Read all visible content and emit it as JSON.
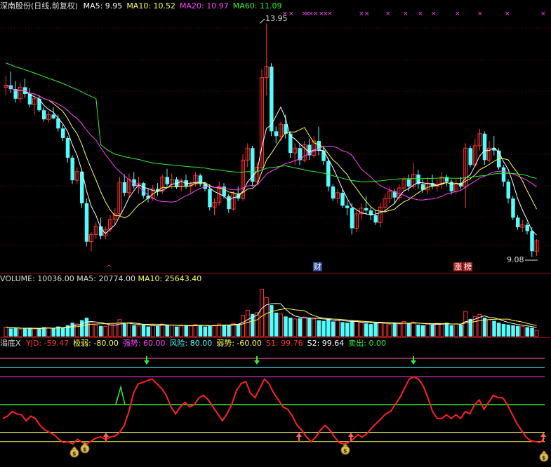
{
  "main": {
    "stock_title": "深南股份(日线,前复权)",
    "ma": [
      {
        "label": "MA5: ",
        "value": "9.95",
        "color": "#ffffff"
      },
      {
        "label": "MA10: ",
        "value": "10.52",
        "color": "#ffff55"
      },
      {
        "label": "MA20: ",
        "value": "10.97",
        "color": "#ff44ff"
      },
      {
        "label": "MA60: ",
        "value": "11.09",
        "color": "#33ee33"
      }
    ],
    "high_label": "13.95",
    "low_label": "9.08",
    "markers": [
      {
        "text": "财",
        "color": "#ffffff",
        "bg": "#2a4a9a"
      },
      {
        "text": "涨",
        "color": "#ffffff",
        "bg": "#aa2222"
      },
      {
        "text": "榜",
        "color": "#ffffff",
        "bg": "#aa2222"
      }
    ],
    "colors": {
      "up": "#ff3232",
      "down": "#54fcfc",
      "ma5": "#ffffff",
      "ma10": "#ffff55",
      "ma20": "#ff44ff",
      "ma60": "#33ee33",
      "grid": "#7a0000"
    }
  },
  "volume": {
    "label": "VOLUME: ",
    "value": "10036.00",
    "ma5_label": "MA5: ",
    "ma5_value": "20774.00",
    "ma10_label": "MA10: ",
    "ma10_value": "25643.40"
  },
  "indicator": {
    "name": "渴底X",
    "items": [
      {
        "label": "YJD: ",
        "value": "-59.47",
        "color": "#ff3333"
      },
      {
        "label": "极弱: ",
        "value": "-80.00",
        "color": "#ffff55"
      },
      {
        "label": "强势: ",
        "value": "60.00",
        "color": "#ff44ff"
      },
      {
        "label": "风险: ",
        "value": "80.00",
        "color": "#54fcfc"
      },
      {
        "label": "弱势: ",
        "value": "-60.00",
        "color": "#ffff55"
      },
      {
        "label": "S1: ",
        "value": "99.76",
        "color": "#ff3333"
      },
      {
        "label": "S2: ",
        "value": "99.64",
        "color": "#ffffff"
      },
      {
        "label": "卖出: ",
        "value": "0.00",
        "color": "#33ee33"
      }
    ],
    "money_glyph": "$"
  },
  "candles": [
    [
      12.62,
      12.85,
      12.45,
      12.66
    ],
    [
      12.66,
      12.95,
      12.5,
      12.58
    ],
    [
      12.58,
      12.75,
      12.3,
      12.38
    ],
    [
      12.38,
      12.72,
      12.3,
      12.62
    ],
    [
      12.62,
      12.8,
      12.4,
      12.48
    ],
    [
      12.48,
      12.6,
      12.2,
      12.26
    ],
    [
      12.26,
      12.45,
      12.05,
      12.38
    ],
    [
      12.38,
      12.45,
      12.1,
      12.14
    ],
    [
      12.14,
      12.2,
      11.9,
      11.95
    ],
    [
      11.95,
      12.12,
      11.88,
      12.05
    ],
    [
      12.05,
      12.2,
      11.95,
      11.97
    ],
    [
      11.97,
      12.05,
      11.7,
      11.76
    ],
    [
      11.76,
      11.84,
      11.5,
      11.56
    ],
    [
      11.56,
      11.6,
      11.05,
      11.15
    ],
    [
      11.15,
      11.2,
      10.6,
      10.68
    ],
    [
      10.68,
      10.95,
      10.6,
      10.86
    ],
    [
      10.86,
      10.9,
      10.1,
      10.2
    ],
    [
      10.2,
      10.3,
      9.3,
      9.4
    ],
    [
      9.4,
      9.6,
      9.2,
      9.55
    ],
    [
      9.55,
      9.8,
      9.45,
      9.72
    ],
    [
      9.72,
      9.9,
      9.45,
      9.52
    ],
    [
      9.52,
      9.72,
      9.45,
      9.66
    ],
    [
      9.66,
      9.95,
      9.6,
      9.86
    ],
    [
      9.86,
      10.1,
      9.75,
      9.98
    ],
    [
      9.98,
      10.75,
      9.95,
      10.64
    ],
    [
      10.64,
      10.8,
      10.35,
      10.42
    ],
    [
      10.42,
      10.82,
      10.3,
      10.7
    ],
    [
      10.7,
      10.85,
      10.5,
      10.56
    ],
    [
      10.56,
      10.75,
      10.4,
      10.62
    ],
    [
      10.62,
      10.65,
      10.3,
      10.36
    ],
    [
      10.36,
      10.5,
      10.22,
      10.3
    ],
    [
      10.3,
      10.58,
      10.25,
      10.5
    ],
    [
      10.5,
      10.62,
      10.35,
      10.45
    ],
    [
      10.45,
      10.8,
      10.4,
      10.75
    ],
    [
      10.75,
      10.92,
      10.55,
      10.6
    ],
    [
      10.6,
      10.82,
      10.5,
      10.7
    ],
    [
      10.7,
      10.75,
      10.5,
      10.55
    ],
    [
      10.55,
      10.72,
      10.45,
      10.68
    ],
    [
      10.68,
      10.8,
      10.5,
      10.56
    ],
    [
      10.56,
      10.66,
      10.4,
      10.6
    ],
    [
      10.6,
      10.85,
      10.55,
      10.78
    ],
    [
      10.78,
      10.82,
      10.55,
      10.6
    ],
    [
      10.6,
      10.65,
      10.45,
      10.5
    ],
    [
      10.5,
      10.6,
      10.05,
      10.12
    ],
    [
      10.12,
      10.3,
      9.95,
      10.22
    ],
    [
      10.22,
      10.65,
      10.15,
      10.55
    ],
    [
      10.55,
      10.62,
      10.3,
      10.35
    ],
    [
      10.35,
      10.4,
      10.0,
      10.08
    ],
    [
      10.08,
      10.45,
      10.05,
      10.4
    ],
    [
      10.4,
      10.55,
      10.25,
      10.3
    ],
    [
      10.3,
      11.22,
      10.25,
      11.1
    ],
    [
      11.1,
      11.45,
      10.95,
      11.35
    ],
    [
      11.35,
      11.4,
      10.55,
      10.65
    ],
    [
      10.65,
      11.05,
      10.6,
      10.95
    ],
    [
      10.95,
      13.0,
      10.9,
      12.82
    ],
    [
      12.82,
      13.95,
      12.45,
      13.05
    ],
    [
      13.05,
      13.12,
      11.6,
      11.7
    ],
    [
      11.7,
      11.8,
      11.45,
      11.6
    ],
    [
      11.6,
      11.9,
      11.5,
      11.85
    ],
    [
      11.85,
      12.05,
      11.55,
      11.65
    ],
    [
      11.65,
      11.7,
      11.15,
      11.25
    ],
    [
      11.25,
      11.45,
      11.0,
      11.35
    ],
    [
      11.35,
      11.45,
      11.0,
      11.1
    ],
    [
      11.1,
      11.5,
      11.05,
      11.42
    ],
    [
      11.42,
      11.55,
      11.1,
      11.2
    ],
    [
      11.2,
      11.6,
      11.15,
      11.5
    ],
    [
      11.5,
      11.8,
      11.2,
      11.3
    ],
    [
      11.3,
      11.4,
      11.0,
      11.08
    ],
    [
      11.08,
      11.15,
      10.45,
      10.55
    ],
    [
      10.55,
      10.6,
      10.25,
      10.3
    ],
    [
      10.3,
      10.5,
      10.2,
      10.42
    ],
    [
      10.42,
      10.48,
      10.1,
      10.15
    ],
    [
      10.15,
      10.25,
      9.95,
      10.1
    ],
    [
      10.1,
      10.2,
      9.55,
      9.68
    ],
    [
      9.68,
      10.05,
      9.6,
      9.98
    ],
    [
      9.98,
      10.2,
      9.85,
      10.1
    ],
    [
      10.1,
      10.35,
      9.95,
      10.05
    ],
    [
      10.05,
      10.12,
      9.85,
      9.95
    ],
    [
      9.95,
      10.05,
      9.75,
      9.8
    ],
    [
      9.8,
      10.2,
      9.7,
      10.12
    ],
    [
      10.12,
      10.4,
      10.0,
      10.3
    ],
    [
      10.3,
      10.55,
      10.2,
      10.45
    ],
    [
      10.45,
      10.5,
      10.2,
      10.32
    ],
    [
      10.32,
      10.6,
      10.25,
      10.52
    ],
    [
      10.52,
      10.75,
      10.45,
      10.7
    ],
    [
      10.7,
      10.8,
      10.45,
      10.55
    ],
    [
      10.55,
      11.05,
      10.5,
      10.8
    ],
    [
      10.8,
      10.9,
      10.5,
      10.6
    ],
    [
      10.6,
      10.7,
      10.42,
      10.48
    ],
    [
      10.48,
      10.75,
      10.4,
      10.62
    ],
    [
      10.62,
      10.8,
      10.5,
      10.55
    ],
    [
      10.55,
      10.7,
      10.45,
      10.6
    ],
    [
      10.6,
      10.85,
      10.5,
      10.75
    ],
    [
      10.75,
      10.8,
      10.55,
      10.65
    ],
    [
      10.65,
      10.7,
      10.38,
      10.45
    ],
    [
      10.45,
      10.7,
      10.4,
      10.62
    ],
    [
      10.62,
      10.75,
      10.5,
      10.55
    ],
    [
      10.55,
      11.45,
      10.1,
      11.35
    ],
    [
      11.35,
      11.4,
      10.95,
      11.0
    ],
    [
      11.0,
      11.55,
      10.95,
      11.4
    ],
    [
      11.4,
      11.75,
      11.3,
      11.65
    ],
    [
      11.65,
      11.7,
      11.0,
      11.1
    ],
    [
      11.1,
      11.5,
      11.05,
      11.35
    ],
    [
      11.35,
      11.6,
      11.2,
      11.3
    ],
    [
      11.3,
      11.35,
      10.9,
      10.95
    ],
    [
      10.95,
      11.0,
      10.55,
      10.65
    ],
    [
      10.65,
      10.7,
      10.2,
      10.3
    ],
    [
      10.3,
      10.35,
      9.85,
      9.9
    ],
    [
      9.9,
      9.95,
      9.65,
      9.7
    ],
    [
      9.7,
      9.85,
      9.6,
      9.75
    ],
    [
      9.75,
      9.8,
      9.55,
      9.62
    ],
    [
      9.62,
      9.7,
      9.08,
      9.2
    ],
    [
      9.2,
      9.45,
      9.1,
      9.42
    ]
  ],
  "volumes": [
    15,
    13,
    14,
    12,
    13,
    14,
    12,
    13,
    15,
    14,
    13,
    16,
    14,
    18,
    22,
    20,
    26,
    30,
    22,
    18,
    17,
    16,
    19,
    21,
    27,
    20,
    22,
    18,
    17,
    19,
    16,
    18,
    17,
    20,
    19,
    18,
    16,
    17,
    18,
    17,
    19,
    18,
    16,
    17,
    18,
    20,
    19,
    18,
    21,
    20,
    34,
    42,
    36,
    38,
    75,
    62,
    50,
    38,
    36,
    32,
    30,
    28,
    29,
    31,
    30,
    28,
    26,
    25,
    28,
    24,
    26,
    23,
    22,
    25,
    24,
    22,
    21,
    20,
    22,
    23,
    21,
    19,
    22,
    20,
    24,
    21,
    23,
    19,
    18,
    20,
    19,
    21,
    20,
    22,
    18,
    20,
    19,
    40,
    28,
    32,
    35,
    30,
    27,
    25,
    22,
    20,
    19,
    18,
    17,
    16,
    15,
    14,
    10
  ],
  "yjd": [
    -30,
    -25,
    -15,
    -20,
    -22,
    -35,
    -25,
    -30,
    -45,
    -55,
    -60,
    -65,
    -75,
    -82,
    -80,
    -85,
    -75,
    -82,
    -85,
    -78,
    -72,
    -70,
    -75,
    -70,
    -68,
    -60,
    -45,
    -15,
    25,
    45,
    48,
    52,
    55,
    45,
    35,
    20,
    -5,
    -20,
    -5,
    5,
    -5,
    0,
    15,
    20,
    10,
    -5,
    -20,
    -35,
    -20,
    0,
    30,
    45,
    50,
    25,
    15,
    35,
    55,
    45,
    25,
    10,
    -5,
    -10,
    -25,
    -45,
    -55,
    -70,
    -80,
    -70,
    -55,
    -45,
    -55,
    -70,
    -82,
    -85,
    -82,
    -75,
    -65,
    -70,
    -62,
    -50,
    -40,
    -30,
    -20,
    -15,
    0,
    15,
    35,
    55,
    60,
    55,
    40,
    15,
    -15,
    -30,
    -30,
    -22,
    -30,
    -22,
    -30,
    -15,
    -20,
    0,
    10,
    -10,
    5,
    20,
    15,
    15,
    0,
    -20,
    -40,
    -55,
    -70,
    -78,
    -80,
    -82,
    -72
  ]
}
